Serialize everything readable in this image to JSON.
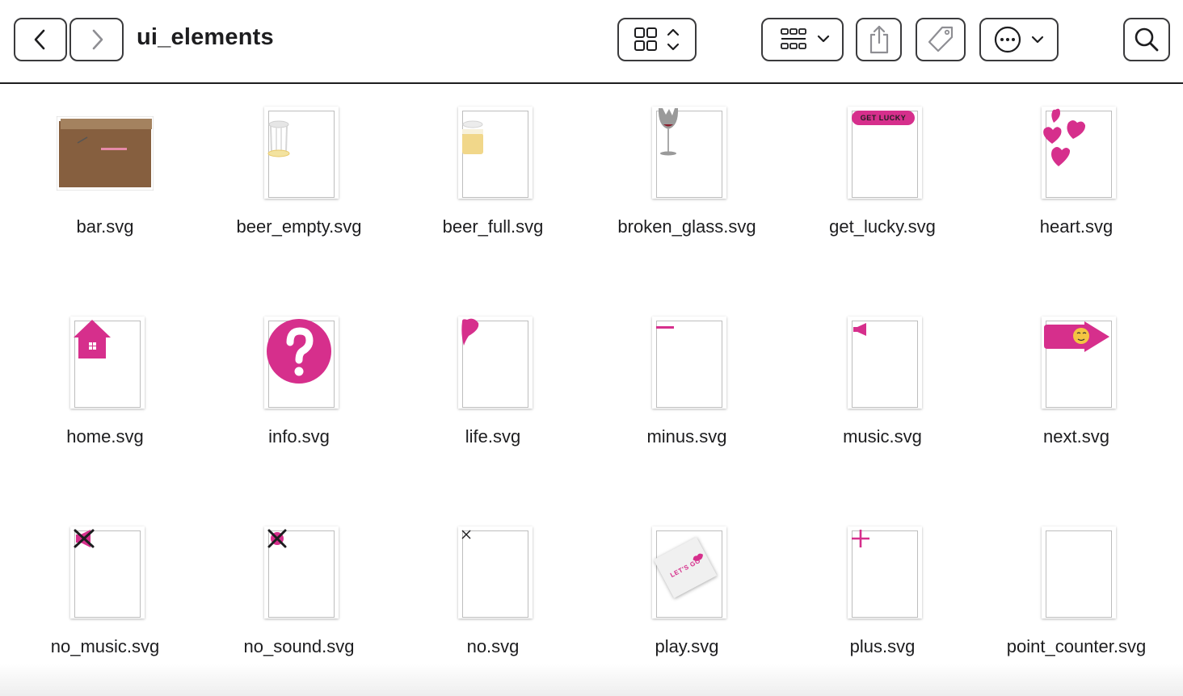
{
  "window": {
    "title": "ui_elements"
  },
  "toolbar": {
    "back_icon": "chevron-left-icon",
    "forward_icon": "chevron-right-icon",
    "view_icon": "icon-grid-view-icon",
    "group_icon": "group-by-icon",
    "share_icon": "share-icon",
    "tag_icon": "tag-icon",
    "action_icon": "more-actions-icon",
    "search_icon": "search-icon"
  },
  "colors": {
    "accent_pink": "#d62f8c",
    "bar_brown": "#865f3f"
  },
  "files": [
    {
      "name": "bar.svg"
    },
    {
      "name": "beer_empty.svg"
    },
    {
      "name": "beer_full.svg"
    },
    {
      "name": "broken_glass.svg"
    },
    {
      "name": "get_lucky.svg",
      "thumb_text": "GET LUCKY"
    },
    {
      "name": "heart.svg"
    },
    {
      "name": "home.svg"
    },
    {
      "name": "info.svg"
    },
    {
      "name": "life.svg"
    },
    {
      "name": "minus.svg"
    },
    {
      "name": "music.svg"
    },
    {
      "name": "next.svg"
    },
    {
      "name": "no_music.svg"
    },
    {
      "name": "no_sound.svg"
    },
    {
      "name": "no.svg"
    },
    {
      "name": "play.svg",
      "thumb_text": "LET'S GO"
    },
    {
      "name": "plus.svg"
    },
    {
      "name": "point_counter.svg"
    }
  ]
}
